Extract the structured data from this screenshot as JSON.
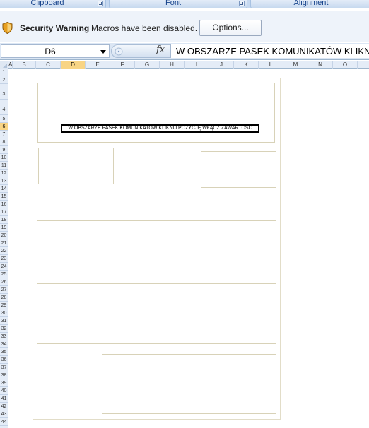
{
  "ribbon": {
    "groups": [
      {
        "label": "Clipboard"
      },
      {
        "label": "Font"
      },
      {
        "label": "Alignment"
      }
    ]
  },
  "message_bar": {
    "title": "Security Warning",
    "message": "Macros have been disabled.",
    "options_label": "Options...",
    "icon": "security-shield-icon"
  },
  "formula_bar": {
    "name_box": "D6",
    "fx_label": "fx",
    "formula": "W OBSZARZE PASEK KOMUNIKATÓW KLIKNIJ"
  },
  "columns": [
    "A",
    "B",
    "C",
    "D",
    "E",
    "F",
    "G",
    "H",
    "I",
    "J",
    "K",
    "L",
    "M",
    "N",
    "O"
  ],
  "selected_column": "D",
  "rows": [
    "1",
    "2",
    "3",
    "4",
    "5",
    "6",
    "7",
    "8",
    "9",
    "10",
    "11",
    "12",
    "13",
    "14",
    "15",
    "16",
    "17",
    "18",
    "19",
    "20",
    "21",
    "22",
    "23",
    "24",
    "25",
    "26",
    "27",
    "28",
    "29",
    "30",
    "31",
    "32",
    "33",
    "34",
    "35",
    "36",
    "37",
    "38",
    "39",
    "40",
    "41",
    "42",
    "43",
    "44"
  ],
  "selected_row": "6",
  "cell_text": "W OBSZARZE PASEK KOMUNIKATÓW KLIKNIJ POZYCJĘ WŁĄCZ ZAWARTOŚĆ",
  "colors": {
    "header_bg": "#e4ecf7",
    "selected_header": "#f8d484",
    "grid_border": "#9eb6ce",
    "ribbon_text": "#15428b"
  }
}
